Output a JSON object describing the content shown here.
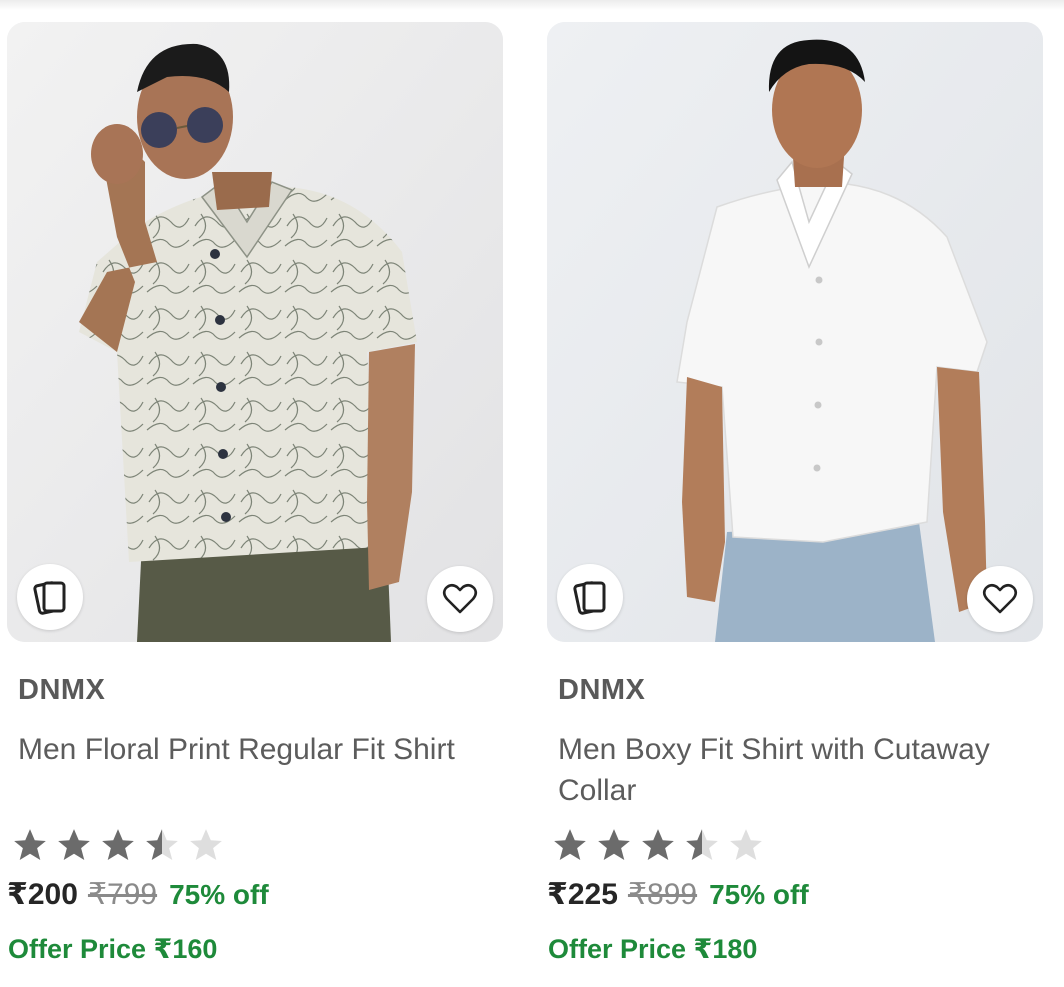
{
  "products": [
    {
      "brand": "DNMX",
      "title": "Men Floral Print Regular Fit Shirt",
      "rating": 3.5,
      "rating_max": 5,
      "price": "₹200",
      "mrp": "₹799",
      "discount": "75% off",
      "offer": "Offer Price ₹160",
      "shirt_color": "#e6e5dc",
      "pants_color": "#575a47",
      "icons": {
        "similar": "similar-products-icon",
        "wishlist": "heart-icon"
      }
    },
    {
      "brand": "DNMX",
      "title": "Men Boxy Fit Shirt with Cutaway Collar",
      "rating": 3.5,
      "rating_max": 5,
      "price": "₹225",
      "mrp": "₹899",
      "discount": "75% off",
      "offer": "Offer Price ₹180",
      "shirt_color": "#f7f7f7",
      "pants_color": "#9cb3c8",
      "icons": {
        "similar": "similar-products-icon",
        "wishlist": "heart-icon"
      }
    }
  ],
  "colors": {
    "star_filled": "#6b6b6b",
    "star_empty": "#dedede",
    "discount_green": "#1e8a3a"
  }
}
